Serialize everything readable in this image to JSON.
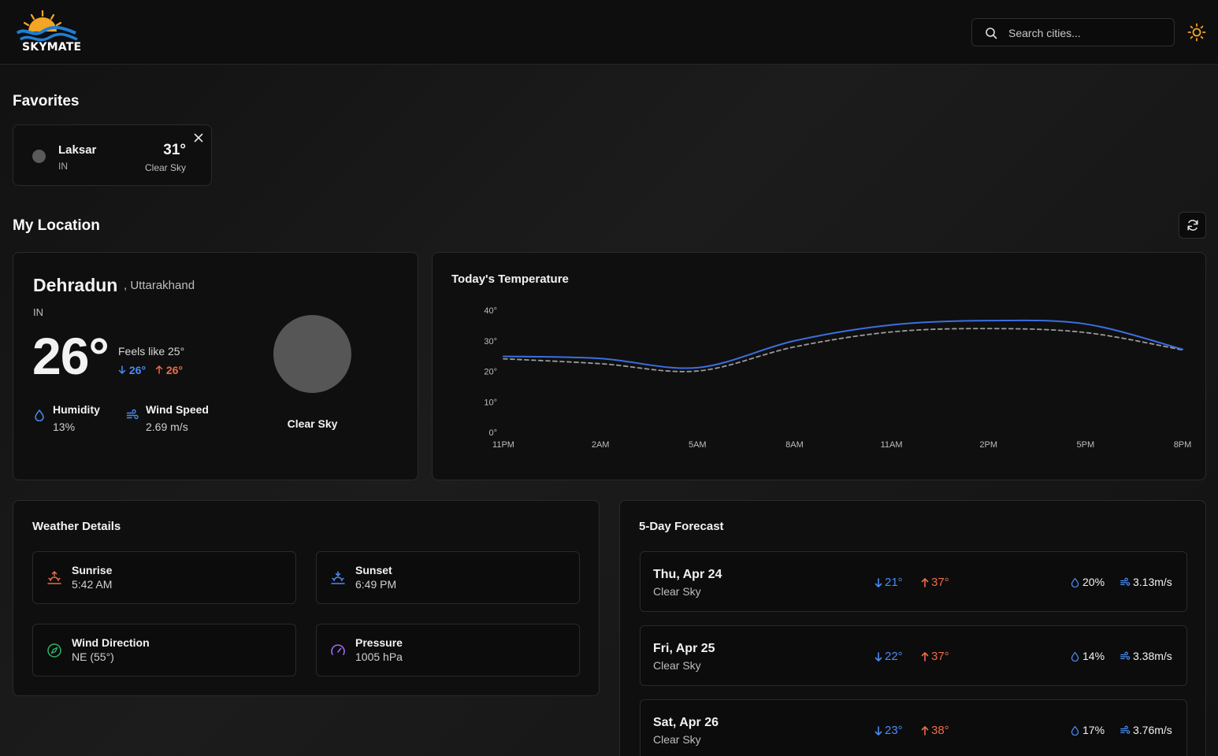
{
  "app": {
    "brand": "SKYMATE"
  },
  "header": {
    "search_placeholder": "Search cities...",
    "theme_icon": "sun-icon"
  },
  "favorites": {
    "title": "Favorites",
    "items": [
      {
        "city": "Laksar",
        "country": "IN",
        "temp": "31°",
        "condition": "Clear Sky"
      }
    ]
  },
  "my_location": {
    "title": "My Location",
    "city": "Dehradun",
    "state": ", Uttarakhand",
    "country": "IN",
    "temp": "26°",
    "feels_like": "Feels like 25°",
    "temp_min": "26°",
    "temp_max": "26°",
    "humidity_label": "Humidity",
    "humidity_value": "13%",
    "wind_label": "Wind Speed",
    "wind_value": "2.69 m/s",
    "condition": "Clear Sky"
  },
  "chart_data": {
    "type": "line",
    "title": "Today's Temperature",
    "x": [
      "11PM",
      "2AM",
      "5AM",
      "8AM",
      "11AM",
      "2PM",
      "5PM",
      "8PM"
    ],
    "yticks": [
      "0°",
      "10°",
      "20°",
      "30°",
      "40°"
    ],
    "ylim": [
      0,
      40
    ],
    "series": [
      {
        "values": [
          24.9,
          24.2,
          21.2,
          30.0,
          35.2,
          36.6,
          35.5,
          27.2
        ],
        "color": "#3b6fe0",
        "style": "solid"
      },
      {
        "values": [
          24.1,
          22.5,
          20.1,
          28.0,
          32.9,
          34.0,
          32.7,
          27.0
        ],
        "color": "#9a9a9a",
        "style": "dashed"
      }
    ],
    "grid": false
  },
  "weather_details": {
    "title": "Weather Details",
    "items": [
      {
        "label": "Sunrise",
        "value": "5:42 AM",
        "icon": "sunrise-icon",
        "color": "#ef6a4a"
      },
      {
        "label": "Sunset",
        "value": "6:49 PM",
        "icon": "sunset-icon",
        "color": "#4a8cf5"
      },
      {
        "label": "Wind Direction",
        "value": "NE (55°)",
        "icon": "compass-icon",
        "color": "#2fb36a"
      },
      {
        "label": "Pressure",
        "value": "1005 hPa",
        "icon": "gauge-icon",
        "color": "#9b6cf0"
      }
    ]
  },
  "forecast": {
    "title": "5-Day Forecast",
    "days": [
      {
        "day": "Thu, Apr 24",
        "condition": "Clear Sky",
        "low": "21°",
        "high": "37°",
        "humidity": "20%",
        "wind": "3.13m/s"
      },
      {
        "day": "Fri, Apr 25",
        "condition": "Clear Sky",
        "low": "22°",
        "high": "37°",
        "humidity": "14%",
        "wind": "3.38m/s"
      },
      {
        "day": "Sat, Apr 26",
        "condition": "Clear Sky",
        "low": "23°",
        "high": "38°",
        "humidity": "17%",
        "wind": "3.76m/s"
      }
    ]
  },
  "colors": {
    "low": "#4a8cf5",
    "high": "#ef6a4a",
    "accent_sun": "#f5a524"
  }
}
